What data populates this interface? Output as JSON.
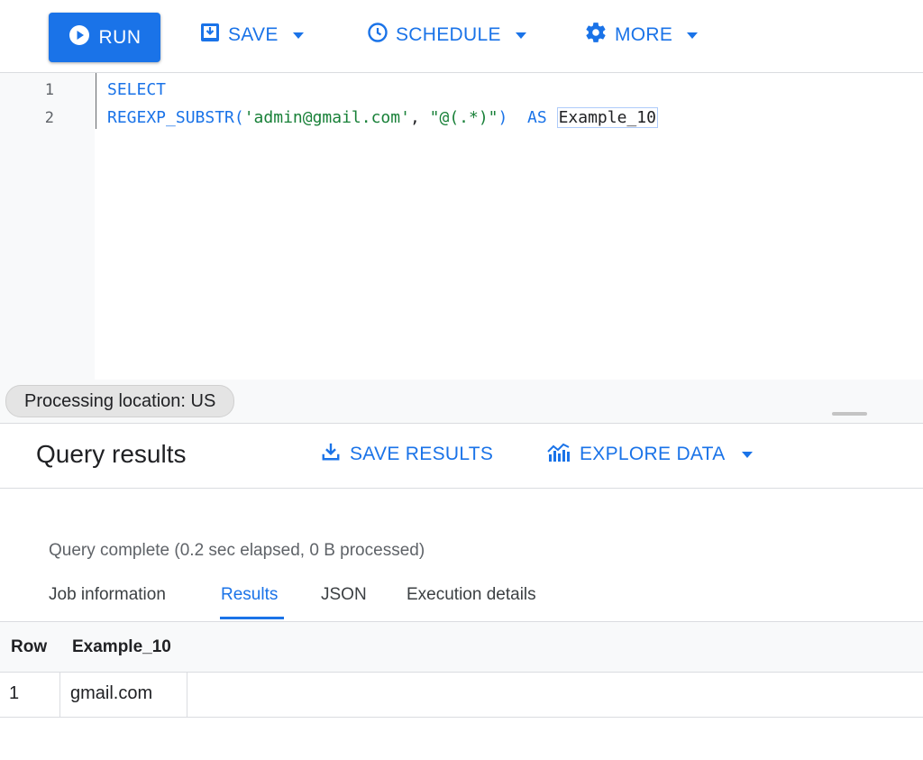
{
  "toolbar": {
    "run_label": "RUN",
    "save_label": "SAVE",
    "schedule_label": "SCHEDULE",
    "more_label": "MORE"
  },
  "editor": {
    "line_numbers": [
      "1",
      "2"
    ],
    "line1": {
      "keyword": "SELECT"
    },
    "line2": {
      "func": "REGEXP_SUBSTR(",
      "arg1": "'admin@gmail.com'",
      "comma": ", ",
      "arg2": "\"@(.*)\"",
      "close": ")",
      "as": "AS",
      "alias": "Example_10"
    }
  },
  "status": {
    "processing_location": "Processing location: US"
  },
  "results": {
    "title": "Query results",
    "save_results_label": "SAVE RESULTS",
    "explore_data_label": "EXPLORE DATA",
    "query_complete": "Query complete (0.2 sec elapsed, 0 B processed)",
    "tabs": [
      {
        "label": "Job information"
      },
      {
        "label": "Results"
      },
      {
        "label": "JSON"
      },
      {
        "label": "Execution details"
      }
    ],
    "table": {
      "columns": [
        "Row",
        "Example_10"
      ],
      "rows": [
        {
          "row": "1",
          "value": "gmail.com"
        }
      ]
    }
  },
  "colors": {
    "accent": "#1a73e8",
    "string": "#188038"
  }
}
